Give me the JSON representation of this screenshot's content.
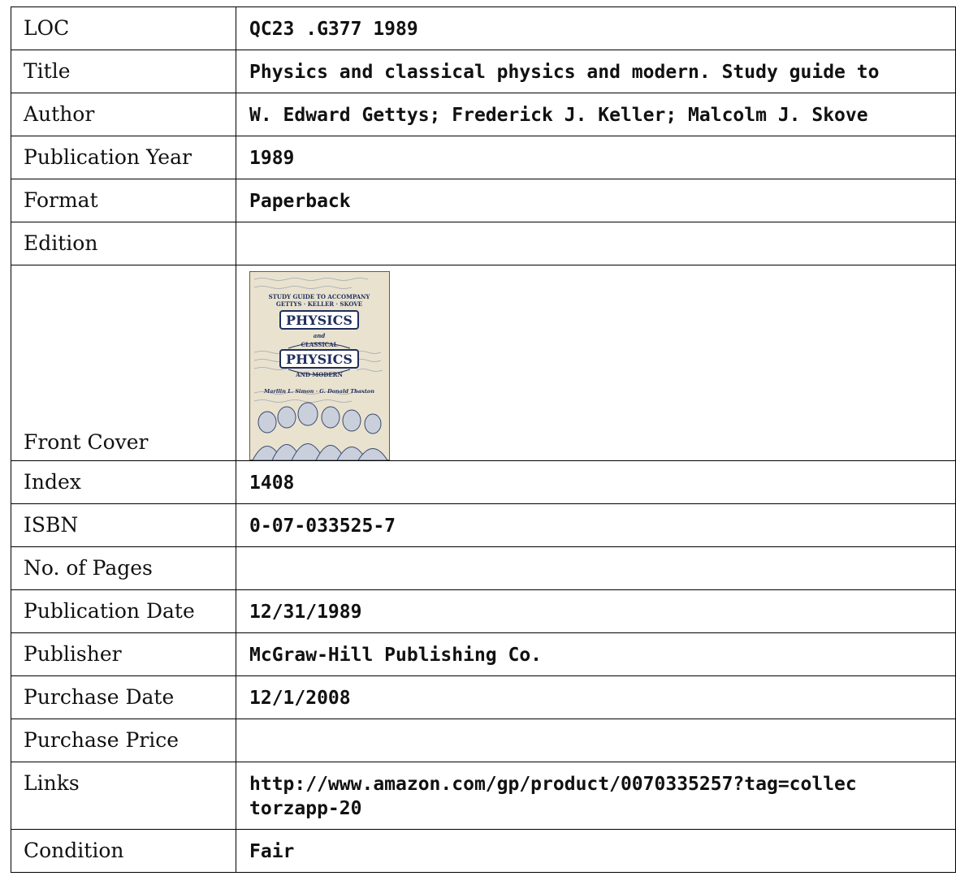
{
  "rows": [
    {
      "label": "LOC",
      "value": "QC23 .G377 1989"
    },
    {
      "label": "Title",
      "value": "Physics and classical physics and modern. Study guide to"
    },
    {
      "label": "Author",
      "value": "W. Edward Gettys; Frederick J. Keller; Malcolm J. Skove"
    },
    {
      "label": "Publication Year",
      "value": "1989"
    },
    {
      "label": "Format",
      "value": "Paperback"
    },
    {
      "label": "Edition",
      "value": ""
    },
    {
      "label": "Front Cover",
      "value": ""
    },
    {
      "label": "Index",
      "value": "1408"
    },
    {
      "label": "ISBN",
      "value": "0-07-033525-7"
    },
    {
      "label": "No. of Pages",
      "value": ""
    },
    {
      "label": "Publication Date",
      "value": "12/31/1989"
    },
    {
      "label": "Publisher",
      "value": "McGraw-Hill Publishing Co."
    },
    {
      "label": "Purchase Date",
      "value": "12/1/2008"
    },
    {
      "label": "Purchase Price",
      "value": ""
    },
    {
      "label": "Links",
      "value": "http://www.amazon.com/gp/product/0070335257?tag=collectorzapp-20"
    },
    {
      "label": "Condition",
      "value": "Fair"
    }
  ],
  "cover": {
    "header_line1": "STUDY GUIDE TO ACCOMPANY",
    "header_line2": "GETTYS · KELLER · SKOVE",
    "title1": "PHYSICS",
    "and": "and",
    "classical": "CLASSICAL",
    "title2": "PHYSICS",
    "modern": "AND MODERN",
    "authors": "Marllin L. Simon · G. Donald Thaxton"
  }
}
